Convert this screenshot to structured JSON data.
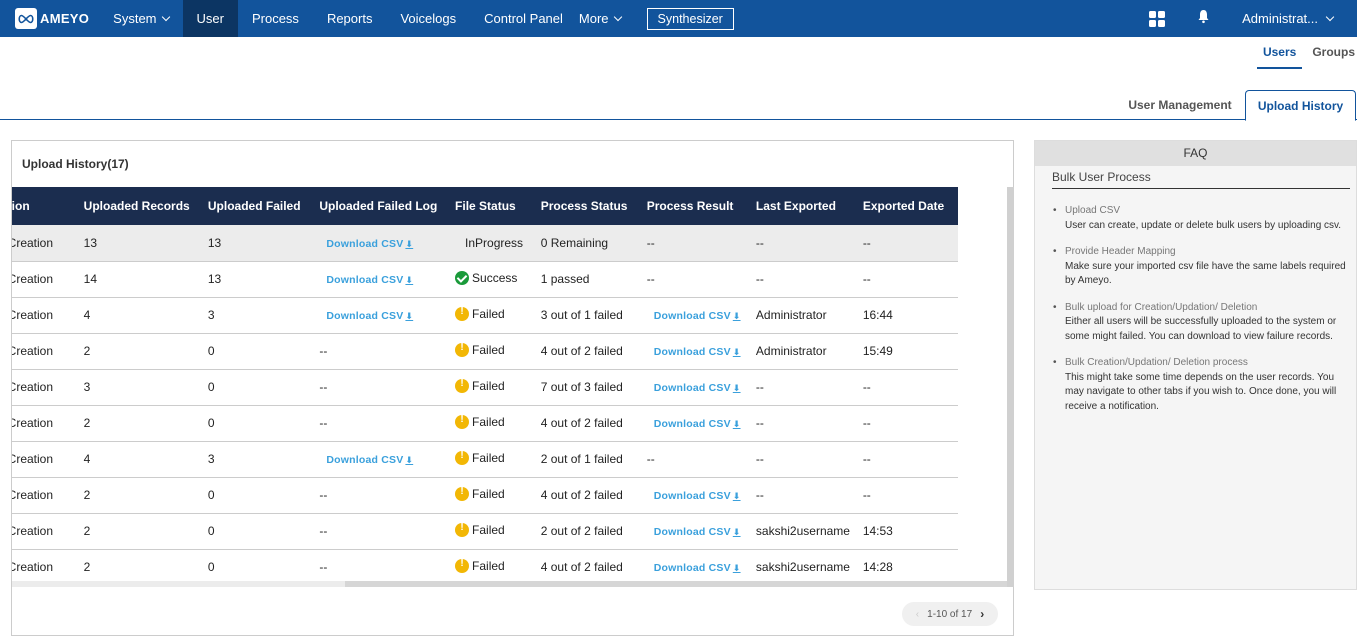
{
  "nav": {
    "brand": "AMEYO",
    "items": [
      {
        "label": "System",
        "dropdown": true
      },
      {
        "label": "User",
        "active": true
      },
      {
        "label": "Process"
      },
      {
        "label": "Reports"
      },
      {
        "label": "Voicelogs"
      },
      {
        "label": "Control Panel"
      },
      {
        "label": "More",
        "dropdown": true
      }
    ],
    "synthesizer_label": "Synthesizer",
    "user_label": "Administrat...",
    "icons": [
      "apps-grid-icon",
      "bell-icon"
    ]
  },
  "subtabs": [
    {
      "label": "Users",
      "active": true
    },
    {
      "label": "Groups"
    }
  ],
  "viewtabs": [
    {
      "label": "User Management"
    },
    {
      "label": "Upload History",
      "active": true
    }
  ],
  "panel": {
    "title": "Upload History(17)",
    "columns": [
      "Operation",
      "Uploaded Records",
      "Uploaded Failed",
      "Uploaded Failed Log",
      "File Status",
      "Process Status",
      "Process Result",
      "Last Exported",
      "Exported Date"
    ],
    "rows": [
      {
        "operation": "Users Creation",
        "records": "13",
        "failed": "13",
        "failed_log": "Download CSV",
        "file_status": "InProgress",
        "status_icon": "none",
        "process_status": "0 Remaining",
        "process_result": "--",
        "last_exported": "--",
        "exported_date": "--"
      },
      {
        "operation": "Users Creation",
        "records": "14",
        "failed": "13",
        "failed_log": "Download CSV",
        "file_status": "Success",
        "status_icon": "ok",
        "process_status": "1 passed",
        "process_result": "--",
        "last_exported": "--",
        "exported_date": "--"
      },
      {
        "operation": "Users Creation",
        "records": "4",
        "failed": "3",
        "failed_log": "Download CSV",
        "file_status": "Failed",
        "status_icon": "warn",
        "process_status": "3 out of 1 failed",
        "process_result": "Download CSV",
        "last_exported": "Administrator",
        "exported_date": "16:44"
      },
      {
        "operation": "Users Creation",
        "records": "2",
        "failed": "0",
        "failed_log": "--",
        "file_status": "Failed",
        "status_icon": "warn",
        "process_status": "4 out of 2 failed",
        "process_result": "Download CSV",
        "last_exported": "Administrator",
        "exported_date": "15:49"
      },
      {
        "operation": "Users Creation",
        "records": "3",
        "failed": "0",
        "failed_log": "--",
        "file_status": "Failed",
        "status_icon": "warn",
        "process_status": "7 out of 3 failed",
        "process_result": "Download CSV",
        "last_exported": "--",
        "exported_date": "--"
      },
      {
        "operation": "Users Creation",
        "records": "2",
        "failed": "0",
        "failed_log": "--",
        "file_status": "Failed",
        "status_icon": "warn",
        "process_status": "4 out of 2 failed",
        "process_result": "Download CSV",
        "last_exported": "--",
        "exported_date": "--"
      },
      {
        "operation": "Users Creation",
        "records": "4",
        "failed": "3",
        "failed_log": "Download CSV",
        "file_status": "Failed",
        "status_icon": "warn",
        "process_status": "2 out of 1 failed",
        "process_result": "--",
        "last_exported": "--",
        "exported_date": "--"
      },
      {
        "operation": "Users Creation",
        "records": "2",
        "failed": "0",
        "failed_log": "--",
        "file_status": "Failed",
        "status_icon": "warn",
        "process_status": "4 out of 2 failed",
        "process_result": "Download CSV",
        "last_exported": "--",
        "exported_date": "--"
      },
      {
        "operation": "Users Creation",
        "records": "2",
        "failed": "0",
        "failed_log": "--",
        "file_status": "Failed",
        "status_icon": "warn",
        "process_status": "2 out of 2 failed",
        "process_result": "Download CSV",
        "last_exported": "sakshi2username",
        "exported_date": "14:53"
      },
      {
        "operation": "Users Creation",
        "records": "2",
        "failed": "0",
        "failed_log": "--",
        "file_status": "Failed",
        "status_icon": "warn",
        "process_status": "4 out of 2 failed",
        "process_result": "Download CSV",
        "last_exported": "sakshi2username",
        "exported_date": "14:28"
      }
    ],
    "pagination": "1-10 of 17"
  },
  "faq": {
    "title": "FAQ",
    "section": "Bulk User Process",
    "items": [
      {
        "q": "Upload CSV",
        "a": "User can create, update or delete bulk users by uploading csv."
      },
      {
        "q": "Provide Header Mapping",
        "a": "Make sure your imported csv file have the same labels required by Ameyo."
      },
      {
        "q": "Bulk upload for Creation/Updation/ Deletion",
        "a": "Either all users will be successfully uploaded to the system or some might failed. You can download to view failure records."
      },
      {
        "q": "Bulk Creation/Updation/ Deletion process",
        "a": "This might take some time depends on the user records. You may navigate to other tabs if you wish to. Once done, you will receive a notification."
      }
    ]
  },
  "colors": {
    "nav_bg": "#12549c",
    "nav_active": "#0c3563",
    "table_header": "#1b2d4f",
    "link": "#3aa0dc",
    "success": "#1a9a3a",
    "warning": "#f2b705"
  }
}
